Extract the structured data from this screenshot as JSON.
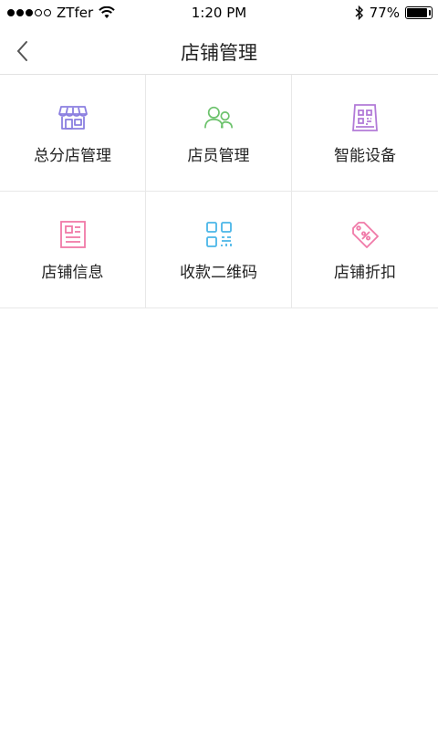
{
  "status_bar": {
    "carrier": "ZTfer",
    "time": "1:20 PM",
    "battery_text": "77%",
    "signal_bars_filled": 3,
    "signal_bars_total": 5,
    "battery_level": 0.77
  },
  "nav": {
    "title": "店铺管理",
    "back_icon": "chevron-left-icon"
  },
  "grid": {
    "items": [
      {
        "label": "总分店管理",
        "icon": "storefront-icon",
        "color": "#8B7FE0"
      },
      {
        "label": "店员管理",
        "icon": "staff-users-icon",
        "color": "#6CC26C"
      },
      {
        "label": "智能设备",
        "icon": "qr-device-icon",
        "color": "#B27BD8"
      },
      {
        "label": "店铺信息",
        "icon": "document-info-icon",
        "color": "#F07AA8"
      },
      {
        "label": "收款二维码",
        "icon": "qr-code-icon",
        "color": "#4AB6E8"
      },
      {
        "label": "店铺折扣",
        "icon": "discount-tag-icon",
        "color": "#F07AA8"
      }
    ]
  }
}
